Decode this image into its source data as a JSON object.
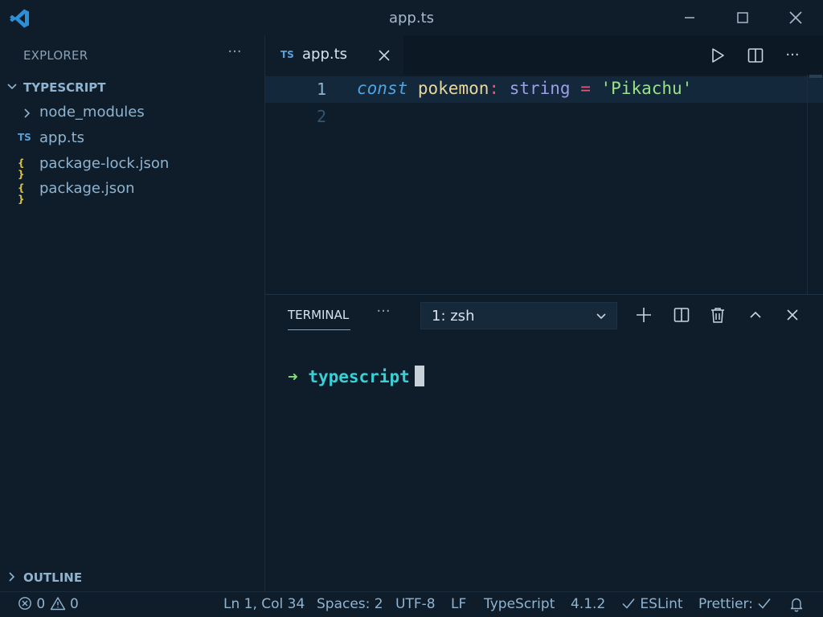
{
  "window": {
    "title": "app.ts"
  },
  "sidebar": {
    "header": "EXPLORER",
    "folder": "TYPESCRIPT",
    "items": [
      {
        "name": "node_modules",
        "type": "folder"
      },
      {
        "name": "app.ts",
        "type": "ts",
        "icon": "TS"
      },
      {
        "name": "package-lock.json",
        "type": "json",
        "icon": "{ }"
      },
      {
        "name": "package.json",
        "type": "json",
        "icon": "{ }"
      }
    ],
    "outline": "OUTLINE"
  },
  "editor": {
    "tab": {
      "label": "app.ts",
      "icon": "TS"
    },
    "lines": [
      "1",
      "2"
    ],
    "code": {
      "keyword": "const",
      "identifier": "pokemon",
      "colon": ":",
      "type": "string",
      "operator": "=",
      "string": "'Pikachu'"
    }
  },
  "terminal": {
    "tab_label": "TERMINAL",
    "selected_shell": "1: zsh",
    "prompt_arrow": "➜",
    "prompt_dir": "typescript"
  },
  "statusbar": {
    "errors": "0",
    "warnings": "0",
    "position": "Ln 1, Col 34",
    "spaces": "Spaces: 2",
    "encoding": "UTF-8",
    "eol": "LF",
    "language": "TypeScript",
    "version": "4.1.2",
    "eslint": "ESLint",
    "prettier": "Prettier:"
  },
  "colors": {
    "background": "#0f1d2b",
    "accent_blue": "#4fa3e0",
    "string_green": "#9be08a",
    "json_yellow": "#d8c24a"
  }
}
